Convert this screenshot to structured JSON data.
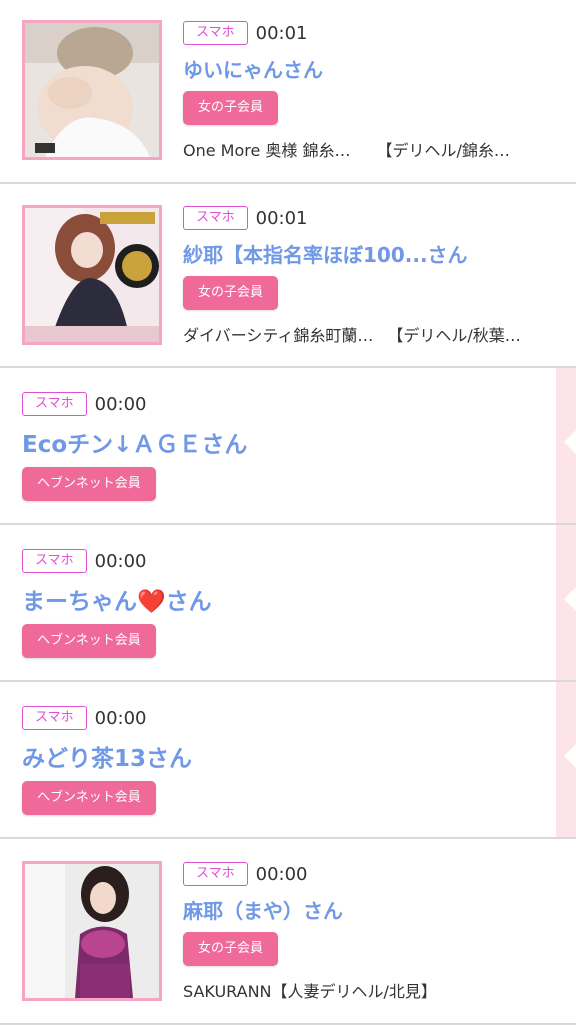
{
  "items": [
    {
      "phone_label": "スマホ",
      "time": "00:01",
      "name": "ゆいにゃんさん",
      "member_label": "女の子会員",
      "shop": "One More 奥様 錦糸…",
      "area": "【デリヘル/錦糸…"
    },
    {
      "phone_label": "スマホ",
      "time": "00:01",
      "name": "紗耶【本指名率ほぼ100...さん",
      "member_label": "女の子会員",
      "shop": "ダイバーシティ錦糸町蘭…",
      "area": "【デリヘル/秋葉…"
    },
    {
      "phone_label": "スマホ",
      "time": "00:00",
      "name": "Ecoチン↓ＡＧＥさん",
      "member_label": "ヘブンネット会員"
    },
    {
      "phone_label": "スマホ",
      "time": "00:00",
      "name": "まーちゃん❤️さん",
      "member_label": "ヘブンネット会員"
    },
    {
      "phone_label": "スマホ",
      "time": "00:00",
      "name": "みどり茶13さん",
      "member_label": "ヘブンネット会員"
    },
    {
      "phone_label": "スマホ",
      "time": "00:00",
      "name": "麻耶（まや）さん",
      "member_label": "女の子会員",
      "shop": "SAKURANN【人妻デリヘル/北見】",
      "area": ""
    }
  ],
  "colors": {
    "name": "#6f98e6",
    "member_badge": "#f06a99",
    "phone_badge": "#e14fd2",
    "thumb_border": "#f6a6c2",
    "side_bar": "#fde4e8"
  }
}
